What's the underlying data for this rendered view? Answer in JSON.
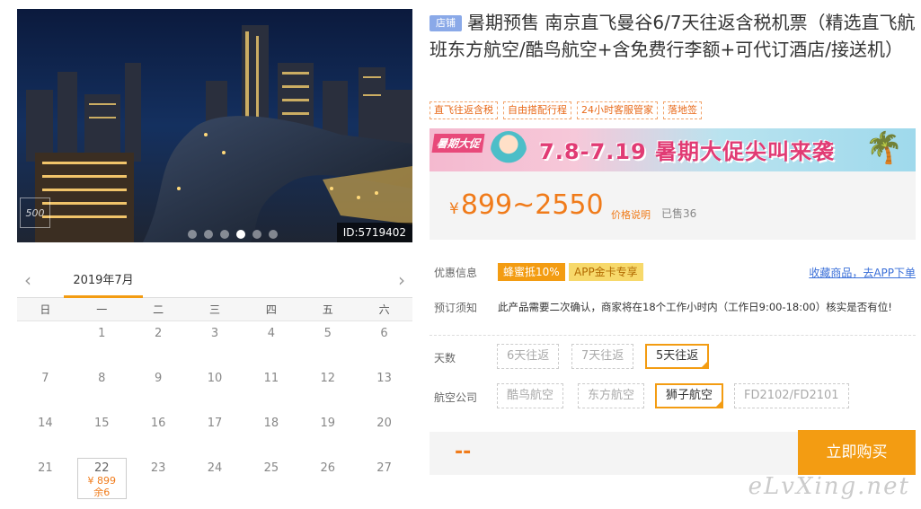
{
  "hero": {
    "image_id": "ID:5719402",
    "logo_text": "500",
    "dot_count": 6,
    "active_dot": 3
  },
  "calendar": {
    "month": "2019年7月",
    "prev_icon": "chevron-left-icon",
    "next_icon": "chevron-right-icon",
    "weekdays": [
      "日",
      "一",
      "二",
      "三",
      "四",
      "五",
      "六"
    ],
    "weeks": [
      [
        "",
        "1",
        "2",
        "3",
        "4",
        "5",
        "6"
      ],
      [
        "7",
        "8",
        "9",
        "10",
        "11",
        "12",
        "13"
      ],
      [
        "14",
        "15",
        "16",
        "17",
        "18",
        "19",
        "20"
      ],
      [
        "21",
        "22",
        "23",
        "24",
        "25",
        "26",
        "27"
      ]
    ],
    "selected": {
      "day": "22",
      "price": "¥ 899",
      "left": "余6"
    }
  },
  "product": {
    "shop_badge": "店铺",
    "title": "暑期预售 南京直飞曼谷6/7天往返含税机票（精选直飞航班东方航空/酷鸟航空+含免费行李额+可代订酒店/接送机）",
    "tags": [
      "直飞往返含税",
      "自由搭配行程",
      "24小时客服管家",
      "落地签"
    ]
  },
  "promo": {
    "tag": "暑期大促",
    "text": "7.8-7.19 暑期大促尖叫来袭",
    "accent": "#e13b74"
  },
  "price": {
    "currency": "¥",
    "range": "899~2550",
    "note": "价格说明",
    "sold": "已售36",
    "color": "#f07b1a"
  },
  "benefit": {
    "label": "优惠信息",
    "badge1": "蜂蜜抵10%",
    "badge2": "APP金卡专享",
    "fav_link": "收藏商品，去APP下单"
  },
  "notice": {
    "label": "预订须知",
    "text": "此产品需要二次确认，商家将在18个工作小时内（工作日9:00-18:00）核实是否有位!"
  },
  "days": {
    "label": "天数",
    "options": [
      "6天往返",
      "7天往返",
      "5天往返"
    ],
    "selected_index": 2
  },
  "airline": {
    "label": "航空公司",
    "options": [
      "酷鸟航空",
      "东方航空",
      "狮子航空",
      "FD2102/FD2101"
    ],
    "selected_index": 2
  },
  "buy": {
    "price_placeholder": "--",
    "button": "立即购买",
    "accent": "#f39c12"
  },
  "watermark": "eLvXing.net"
}
